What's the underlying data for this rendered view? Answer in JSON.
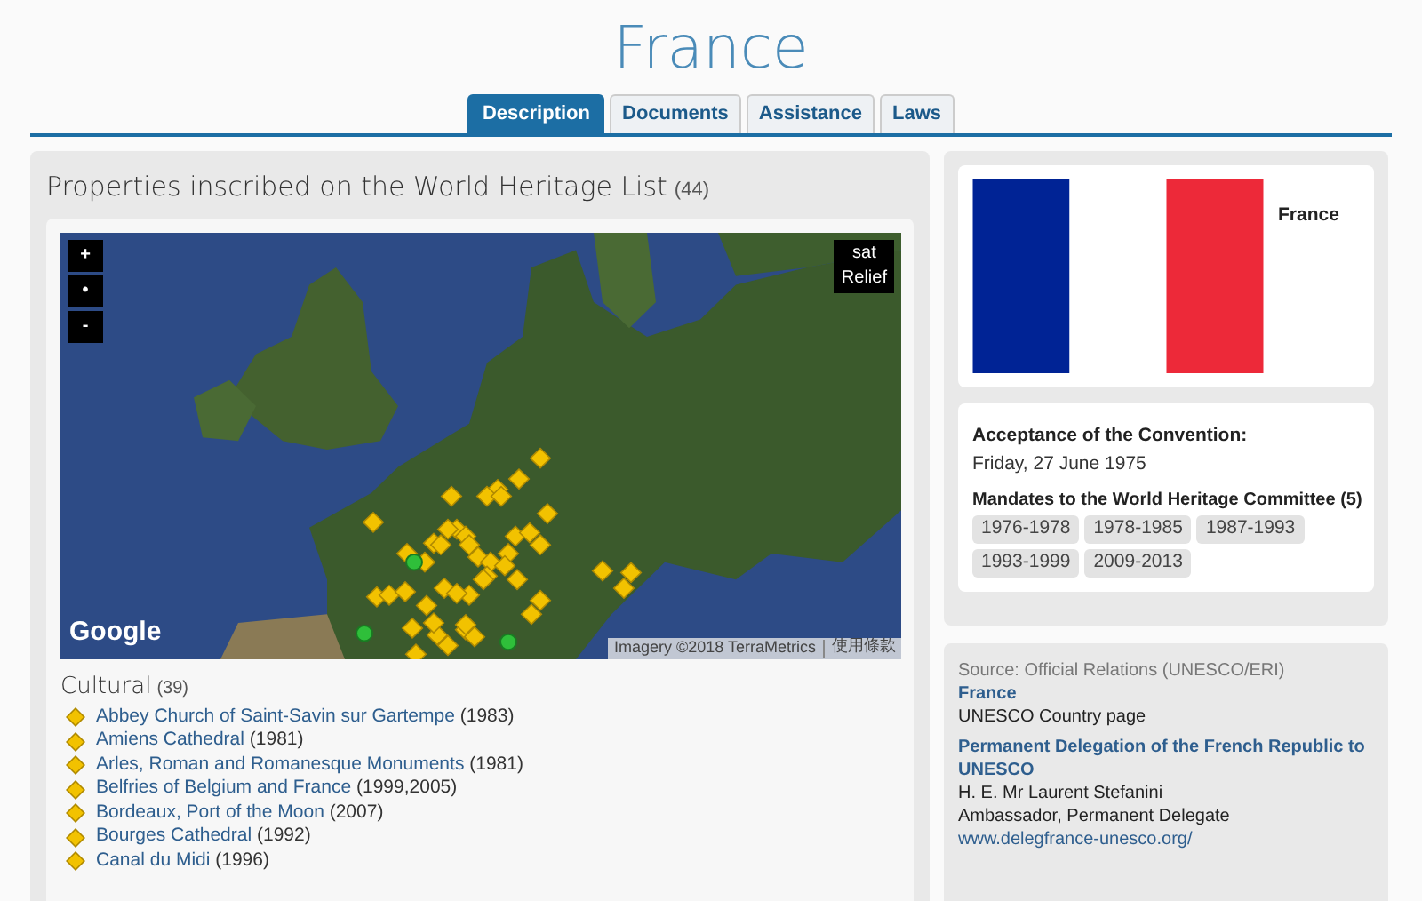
{
  "page_title": "France",
  "tabs": [
    {
      "label": "Description",
      "selected": true
    },
    {
      "label": "Documents",
      "selected": false
    },
    {
      "label": "Assistance",
      "selected": false
    },
    {
      "label": "Laws",
      "selected": false
    }
  ],
  "properties": {
    "heading": "Properties inscribed on the World Heritage List",
    "count": "(44)",
    "map": {
      "zoom_buttons": [
        "+",
        "•",
        "-"
      ],
      "layer_buttons": [
        "sat",
        "Relief"
      ],
      "logo": "Google",
      "attribution": "Imagery ©2018 TerraMetrics",
      "terms": "使用條款"
    },
    "cultural": {
      "heading": "Cultural",
      "count": "(39)",
      "items": [
        {
          "name": "Abbey Church of Saint-Savin sur Gartempe",
          "years": "(1983)"
        },
        {
          "name": "Amiens Cathedral",
          "years": "(1981)"
        },
        {
          "name": "Arles, Roman and Romanesque Monuments",
          "years": "(1981)"
        },
        {
          "name": "Belfries of Belgium and France",
          "years": "(1999,2005)"
        },
        {
          "name": "Bordeaux, Port of the Moon",
          "years": "(2007)"
        },
        {
          "name": "Bourges Cathedral",
          "years": "(1992)"
        },
        {
          "name": "Canal du Midi",
          "years": "(1996)"
        }
      ]
    }
  },
  "flag_card": {
    "country": "France"
  },
  "convention": {
    "label": "Acceptance of the Convention:",
    "date": "Friday, 27 June 1975",
    "mandates_label": "Mandates to the World Heritage Committee (5)",
    "mandates": [
      "1976-1978",
      "1978-1985",
      "1987-1993",
      "1993-1999",
      "2009-2013"
    ]
  },
  "relations": {
    "source": "Source: Official Relations (UNESCO/ERI)",
    "country_link": "France",
    "country_note": "UNESCO Country page",
    "delegation_link": "Permanent Delegation of the French Republic to UNESCO",
    "delegate": "H. E. Mr Laurent Stefanini",
    "role": "Ambassador, Permanent Delegate",
    "website": "www.delegfrance-unesco.org/"
  }
}
